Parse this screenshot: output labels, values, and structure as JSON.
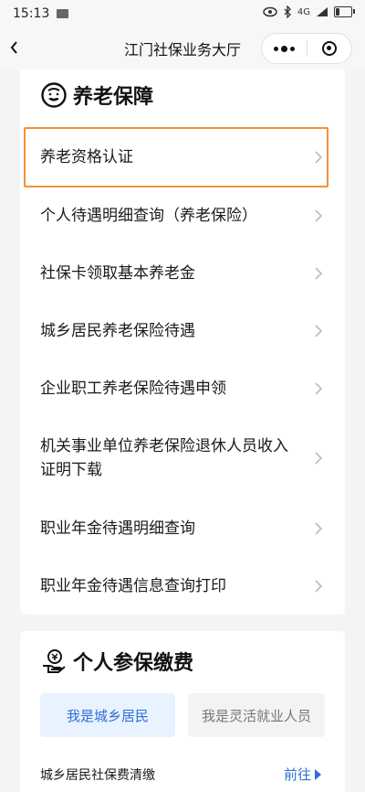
{
  "statusbar": {
    "time": "15:13",
    "signal": "4G"
  },
  "navbar": {
    "title": "江门社保业务大厅"
  },
  "pension": {
    "title": "养老保障",
    "items": [
      {
        "label": "养老资格认证"
      },
      {
        "label": "个人待遇明细查询（养老保险）"
      },
      {
        "label": "社保卡领取基本养老金"
      },
      {
        "label": "城乡居民养老保险待遇"
      },
      {
        "label": "企业职工养老保险待遇申领"
      },
      {
        "label": "机关事业单位养老保险退休人员收入证明下载"
      },
      {
        "label": "职业年金待遇明细查询"
      },
      {
        "label": "职业年金待遇信息查询打印"
      }
    ]
  },
  "insurance": {
    "title": "个人参保缴费",
    "tabs": [
      {
        "label": "我是城乡居民",
        "active": true
      },
      {
        "label": "我是灵活就业人员",
        "active": false
      }
    ],
    "rows": [
      {
        "label": "城乡居民社保费清缴",
        "action": "前往"
      }
    ]
  },
  "colors": {
    "accent": "#2f6fd6",
    "highlight": "#f0913a"
  }
}
